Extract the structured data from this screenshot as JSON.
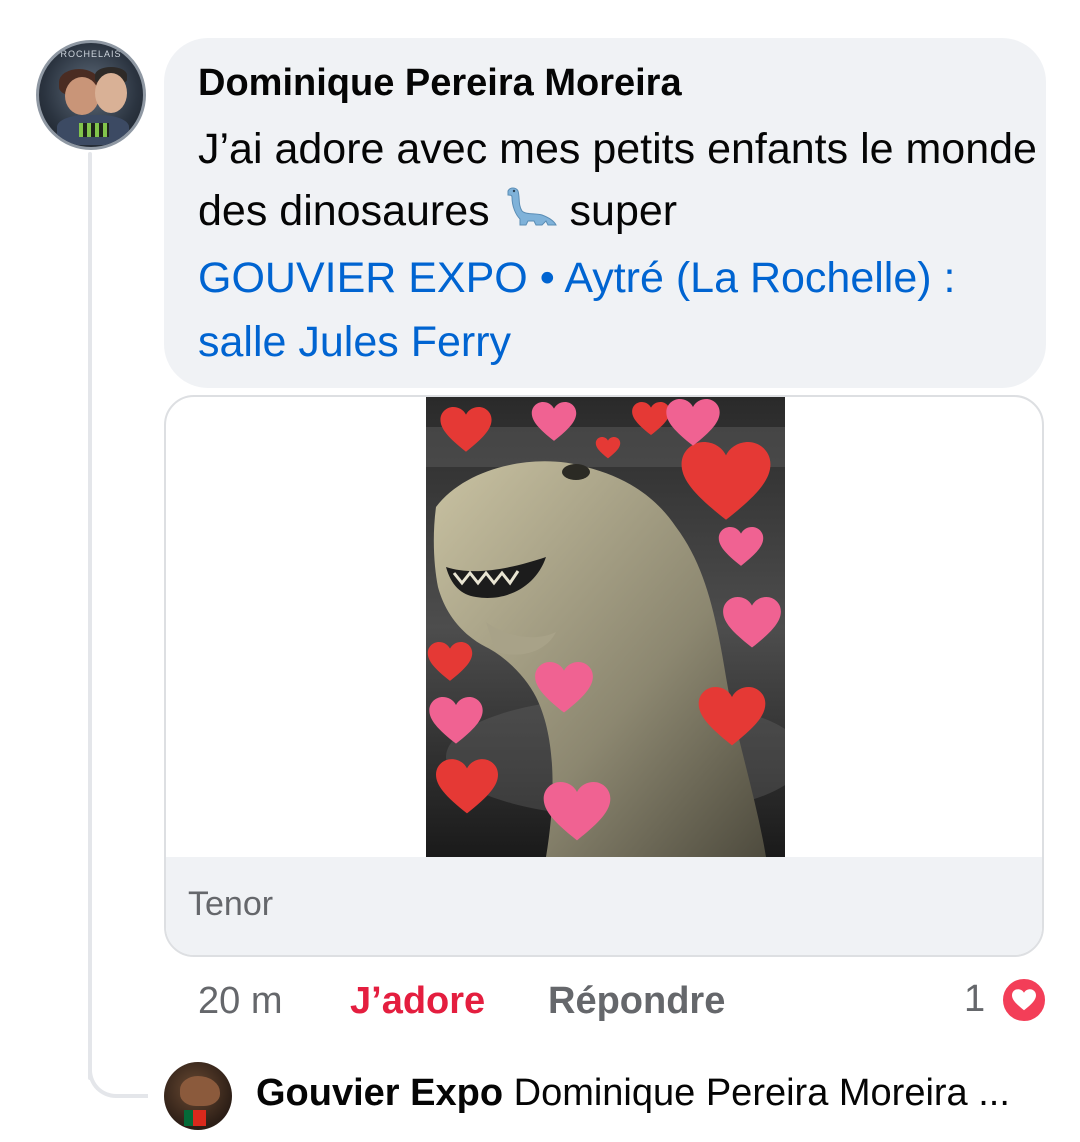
{
  "comment": {
    "author": "Dominique Pereira Moreira",
    "text": "J’ai adore avec mes petits enfants le monde des dinosaures",
    "emoji": "sauropod-emoji",
    "text_after_emoji": "super",
    "link": "GOUVIER EXPO • Aytré (La Rochelle) : salle Jules Ferry",
    "avatar_ring_text": "ROCHELAIS"
  },
  "media": {
    "source_label": "Tenor",
    "gif_subject": "dinosaur-with-hearts-gif"
  },
  "actions": {
    "time": "20 m",
    "like_label": "J’adore",
    "reply_label": "Répondre",
    "reaction_count": "1",
    "reaction_icon": "love-reaction-icon"
  },
  "reply_preview": {
    "author": "Gouvier Expo",
    "text": "Dominique Pereira Moreira ..."
  },
  "colors": {
    "bubble": "#f0f2f5",
    "link": "#0064d1",
    "like_active": "#e41e3f",
    "muted": "#65676b",
    "reaction": "#f33e58"
  }
}
